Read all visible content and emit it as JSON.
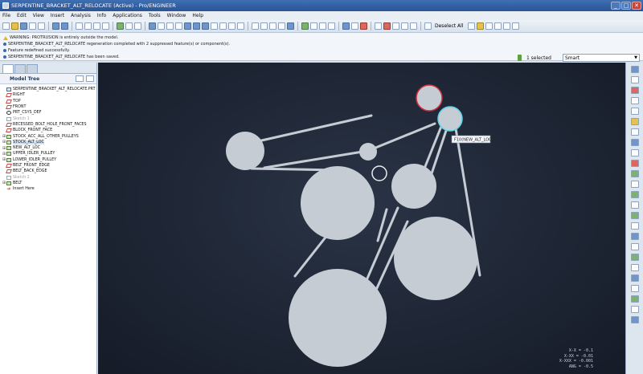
{
  "window": {
    "title": "SERPENTINE_BRACKET_ALT_RELOCATE (Active) - Pro/ENGINEER",
    "minimize": "_",
    "maximize": "□",
    "close": "✕"
  },
  "menu": [
    "File",
    "Edit",
    "View",
    "Insert",
    "Analysis",
    "Info",
    "Applications",
    "Tools",
    "Window",
    "Help"
  ],
  "toolbar": {
    "deselect_label": "Deselect All"
  },
  "messages": [
    {
      "type": "warning",
      "text": "WARNING: PROTRUSION is entirely outside the model."
    },
    {
      "type": "info",
      "text": "SERPENTINE_BRACKET_ALT_RELOCATE regeneration completed with 2 suppressed feature(s) or component(s)."
    },
    {
      "type": "info",
      "text": "Feature redefined successfully."
    },
    {
      "type": "info",
      "text": "SERPENTINE_BRACKET_ALT_RELOCATE has been saved."
    }
  ],
  "selection": {
    "count": "1 selected",
    "filter": "Smart"
  },
  "model_tree": {
    "header": "Model Tree",
    "items": [
      {
        "label": "SERPENTINE_BRACKET_ALT_RELOCATE.PRT",
        "kind": "part",
        "expand": ""
      },
      {
        "label": "RIGHT",
        "kind": "datum",
        "expand": ""
      },
      {
        "label": "TOP",
        "kind": "datum",
        "expand": ""
      },
      {
        "label": "FRONT",
        "kind": "datum",
        "expand": ""
      },
      {
        "label": "PRT_CSYS_DEF",
        "kind": "csys",
        "expand": ""
      },
      {
        "label": "Sketch 1",
        "kind": "sketch",
        "expand": "",
        "grey": true
      },
      {
        "label": "RECESSED_BOLT_HOLE_FRONT_FACES",
        "kind": "datum",
        "expand": ""
      },
      {
        "label": "BLOCK_FRONT_FACE",
        "kind": "datum",
        "expand": ""
      },
      {
        "label": "STOCK_ACC_ALL_OTHER_PULLEYS",
        "kind": "feat",
        "expand": "⊞"
      },
      {
        "label": "STOCK_ALT_LOC",
        "kind": "feat",
        "expand": "⊞",
        "selected": true
      },
      {
        "label": "NEW_ALT_LOC",
        "kind": "feat",
        "expand": "⊞"
      },
      {
        "label": "UPPER_IDLER_PULLEY",
        "kind": "feat",
        "expand": "⊞"
      },
      {
        "label": "LOWER_IDLER_PULLEY",
        "kind": "feat",
        "expand": "⊞"
      },
      {
        "label": "BELT_FRONT_EDGE",
        "kind": "datum",
        "expand": ""
      },
      {
        "label": "BELT_BACK_EDGE",
        "kind": "datum",
        "expand": ""
      },
      {
        "label": "Sketch 2",
        "kind": "sketch",
        "expand": "",
        "grey": true
      },
      {
        "label": "BELT",
        "kind": "feat",
        "expand": "⊞"
      },
      {
        "label": "Insert Here",
        "kind": "insert",
        "expand": ""
      }
    ]
  },
  "graphics": {
    "tooltip": "F10(NEW_ALT_LOC)",
    "colors": {
      "pulley": "#c5ccd4",
      "belt": "#c5ccd4",
      "highlight_red": "#d0313e",
      "highlight_cyan": "#5fd4e6",
      "outline_idler": "#e8ecf0"
    },
    "readout": [
      "X-X = -0.1",
      "X-XX = -0.01",
      "X-XXX = -0.001",
      "ANG = -0.5"
    ]
  }
}
